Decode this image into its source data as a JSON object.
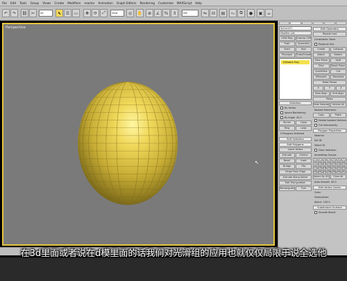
{
  "menubar": {
    "items": [
      "File",
      "Edit",
      "Tools",
      "Group",
      "Views",
      "Create",
      "Modifiers",
      "reactor",
      "Animation",
      "Graph Editors",
      "Rendering",
      "Customize",
      "MAXScript",
      "Help"
    ]
  },
  "toolbar": {
    "filter_dropdown": "All",
    "view_dropdown": "View",
    "named_selection": "SW"
  },
  "viewport": {
    "label": "Perspective",
    "border_color": "#e6c63e",
    "background_color": "#7a7a7a",
    "sphere_color": "#c9b03a"
  },
  "command_panel": {
    "object_name": "Sphere01",
    "modifier_list": "Modifier List",
    "modifier_buttons": [
      "UVW Map",
      "Unwrap UVW",
      "Push",
      "Symmetry",
      "Shell",
      "Skin",
      "Physique",
      "TurboSmooth"
    ],
    "modifier_stack": [
      "Editable Poly"
    ],
    "selection_rollout": "Selection",
    "selection_options": [
      "By Vertex",
      "Ignore Backfacing",
      "By Angle"
    ],
    "angle_value": "45.0",
    "selection_buttons": [
      "Shrink",
      "Grow",
      "Ring",
      "Loop"
    ],
    "selection_status": "0 Polygons Selected",
    "soft_selection_rollout": "Soft Selection",
    "edit_polygons_rollout": "Edit Polygons",
    "edit_polygons_buttons": [
      "Insert Vertex",
      "Extrude",
      "Outline",
      "Bevel",
      "Inset",
      "Bridge",
      "Flip",
      "Hinge From Edge",
      "Extrude Along Spline",
      "Edit Triangulation",
      "Retriangulate",
      "Turn"
    ],
    "edit_geometry_rollout": "Edit Geometry",
    "edit_geometry_buttons": [
      "Repeat Last",
      "Constraints",
      "None",
      "Preserve UVs",
      "Create",
      "Collapse",
      "Attach",
      "Detach",
      "Slice Plane",
      "Split",
      "Slice",
      "Reset Plane",
      "QuickSlice",
      "Cut",
      "MSmooth",
      "Tessellate",
      "Make Planar",
      "X",
      "Y",
      "Z",
      "View Align",
      "Grid Align",
      "Relax",
      "Hide Selected",
      "Unhide All"
    ],
    "named_selections": [
      "Named Selections:",
      "Copy",
      "Paste",
      "Delete Isolated Vertices",
      "Full Interactivity"
    ],
    "polygon_properties_rollout": "Polygon Properties",
    "material_label": "Material",
    "set_id_label": "Set ID:",
    "select_id_label": "Select ID",
    "clear_selection_label": "Clear Selection",
    "smoothing_groups_label": "Smoothing Groups",
    "smoothing_groups": [
      "1",
      "2",
      "3",
      "4",
      "5",
      "6",
      "7",
      "8",
      "9",
      "10",
      "11",
      "12",
      "13",
      "14",
      "15",
      "16",
      "17",
      "18",
      "19",
      "20",
      "21",
      "22",
      "23",
      "24",
      "25",
      "26",
      "27",
      "28",
      "29",
      "30",
      "31",
      "32"
    ],
    "select_by_sg": "Select By SG",
    "clear_all": "Clear All",
    "auto_smooth": "Auto Smooth",
    "auto_smooth_value": "45.0",
    "edit_vertex_colors": "Edit Vertex Colors",
    "color_label": "Color:",
    "illumination_label": "Illumination:",
    "alpha_label": "Alpha:",
    "alpha_value": "100.0",
    "subdivision_surface": "Subdivision Surface",
    "smooth_result": "Smooth Result"
  },
  "subtitle": {
    "text": "在3d里面或者说在d模里面的话我们对光滑组的应用也就仅仅局限于说全选他"
  }
}
